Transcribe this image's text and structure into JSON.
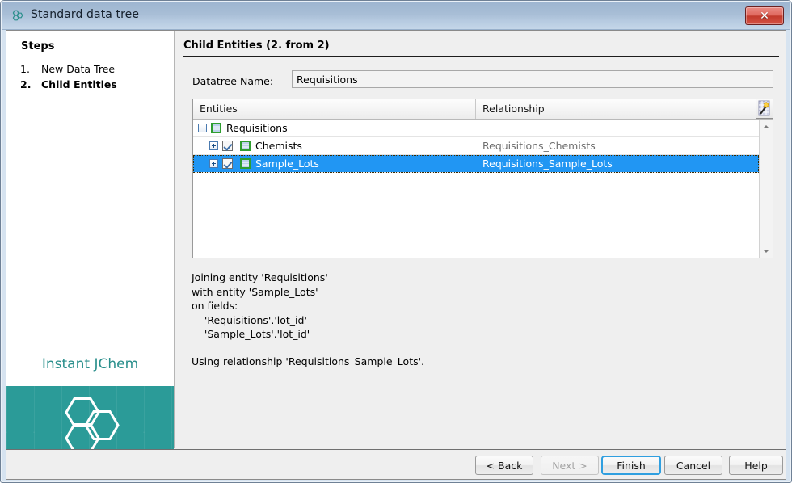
{
  "window": {
    "title": "Standard data tree",
    "icon": "jchem-hexagons-icon",
    "close_label": "✕"
  },
  "sidebar": {
    "heading": "Steps",
    "steps": [
      {
        "number": "1.",
        "label": "New Data Tree",
        "current": false
      },
      {
        "number": "2.",
        "label": "Child Entities",
        "current": true
      }
    ],
    "brand": {
      "name": "Instant JChem",
      "accent_color": "#2a8f8c",
      "panel_color": "#2b9b98"
    }
  },
  "main": {
    "title": "Child Entities (2. from 2)",
    "datatree_name_label": "Datatree Name:",
    "datatree_name_value": "Requisitions",
    "datatree_name_placeholder": "",
    "table": {
      "columns": [
        "Entities",
        "Relationship"
      ],
      "wand_icon": "magic-wand-icon",
      "rows": [
        {
          "entity": "Requisitions",
          "relationship": "",
          "indent": 0,
          "expander": "minus",
          "has_checkbox": false,
          "checked": false,
          "selected": false
        },
        {
          "entity": "Chemists",
          "relationship": "Requisitions_Chemists",
          "indent": 1,
          "expander": "plus",
          "has_checkbox": true,
          "checked": true,
          "selected": false
        },
        {
          "entity": "Sample_Lots",
          "relationship": "Requisitions_Sample_Lots",
          "indent": 1,
          "expander": "plus",
          "has_checkbox": true,
          "checked": true,
          "selected": true
        }
      ],
      "selection_color": "#2196f3"
    },
    "description": "Joining entity 'Requisitions'\nwith entity 'Sample_Lots'\non fields:\n    'Requisitions'.'lot_id'\n    'Sample_Lots'.'lot_id'",
    "description_2": "Using relationship 'Requisitions_Sample_Lots'."
  },
  "footer": {
    "buttons": [
      {
        "id": "back",
        "label": "< Back",
        "state": "enabled"
      },
      {
        "id": "next",
        "label": "Next >",
        "state": "disabled"
      },
      {
        "id": "finish",
        "label": "Finish",
        "state": "default"
      },
      {
        "id": "cancel",
        "label": "Cancel",
        "state": "enabled"
      },
      {
        "id": "help",
        "label": "Help",
        "state": "enabled"
      }
    ]
  }
}
